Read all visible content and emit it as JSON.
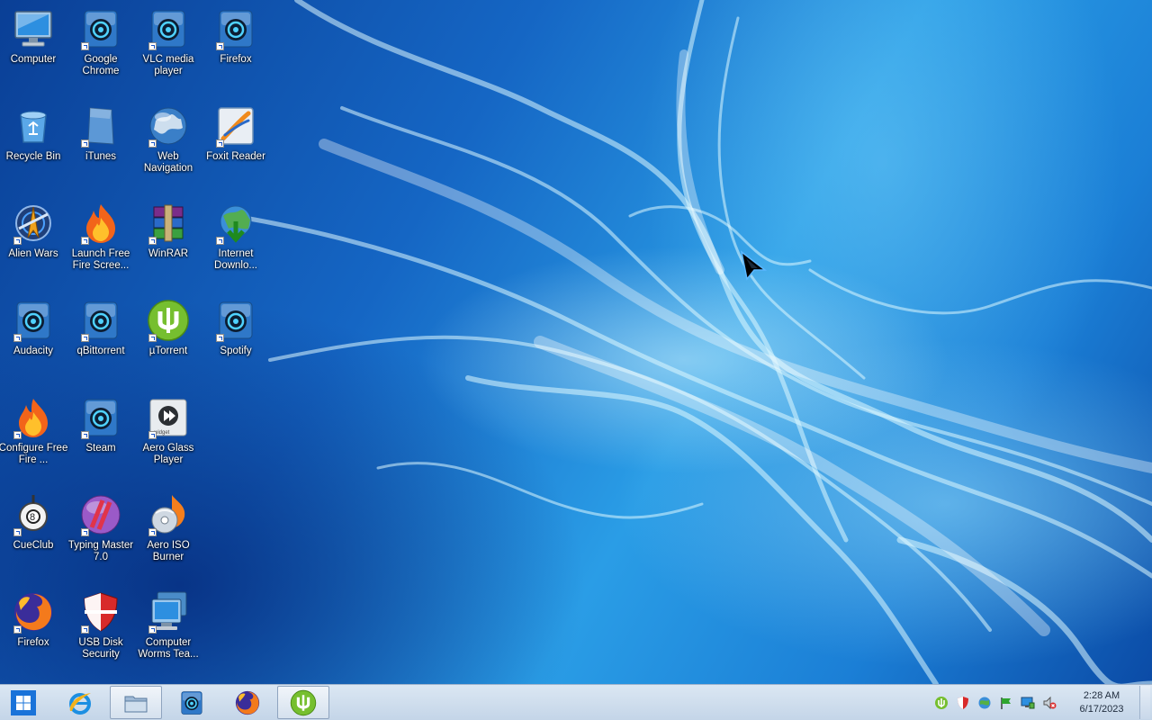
{
  "desktop": {
    "icons": [
      {
        "label": "Computer",
        "icon": "computer-icon"
      },
      {
        "label": "Google Chrome",
        "icon": "media-disc-icon"
      },
      {
        "label": "VLC media player",
        "icon": "media-disc-icon"
      },
      {
        "label": "Firefox",
        "icon": "media-disc-icon"
      },
      {
        "label": "Recycle Bin",
        "icon": "recycle-bin-icon"
      },
      {
        "label": "iTunes",
        "icon": "blank-document-icon"
      },
      {
        "label": "Web Navigation",
        "icon": "globe-icon"
      },
      {
        "label": "Foxit Reader",
        "icon": "pdf-reader-icon"
      },
      {
        "label": "Alien Wars",
        "icon": "game-icon"
      },
      {
        "label": "Launch Free Fire Scree...",
        "icon": "flame-icon"
      },
      {
        "label": "WinRAR",
        "icon": "archive-books-icon"
      },
      {
        "label": "Internet Downlo...",
        "icon": "download-globe-icon"
      },
      {
        "label": "Audacity",
        "icon": "media-disc-icon"
      },
      {
        "label": "qBittorrent",
        "icon": "media-disc-icon"
      },
      {
        "label": "µTorrent",
        "icon": "utorrent-icon"
      },
      {
        "label": "Spotify",
        "icon": "media-disc-icon"
      },
      {
        "label": "Configure Free Fire ...",
        "icon": "flame-icon"
      },
      {
        "label": "Steam",
        "icon": "media-disc-icon"
      },
      {
        "label": "Aero Glass Player",
        "icon": "media-player-icon"
      },
      {
        "label": "CueClub",
        "icon": "billiard-icon"
      },
      {
        "label": "Typing Master 7.0",
        "icon": "typing-icon"
      },
      {
        "label": "Aero ISO Burner",
        "icon": "disc-burner-icon"
      },
      {
        "label": "Firefox",
        "icon": "firefox-icon"
      },
      {
        "label": "USB Disk Security",
        "icon": "shield-icon"
      },
      {
        "label": "Computer Worms Tea...",
        "icon": "monitor-stack-icon"
      }
    ]
  },
  "taskbar": {
    "buttons": [
      {
        "name": "internet-explorer",
        "icon": "internet-explorer-icon"
      },
      {
        "name": "file-explorer",
        "icon": "folder-icon"
      },
      {
        "name": "media-app",
        "icon": "media-disc-icon"
      },
      {
        "name": "firefox",
        "icon": "firefox-icon"
      },
      {
        "name": "utorrent",
        "icon": "utorrent-icon"
      }
    ],
    "tray_icons": [
      "utorrent-tray-icon",
      "shield-tray-icon",
      "network-globe-icon",
      "flag-icon",
      "monitor-network-icon",
      "volume-muted-icon"
    ],
    "clock": {
      "time": "2:28 AM",
      "date": "6/17/2023"
    }
  },
  "colors": {
    "taskbar_bg": "#c9d8ea",
    "label_text": "#ffffff",
    "utorrent_green": "#6ab42a",
    "desktop_blue": "#1566c4"
  }
}
